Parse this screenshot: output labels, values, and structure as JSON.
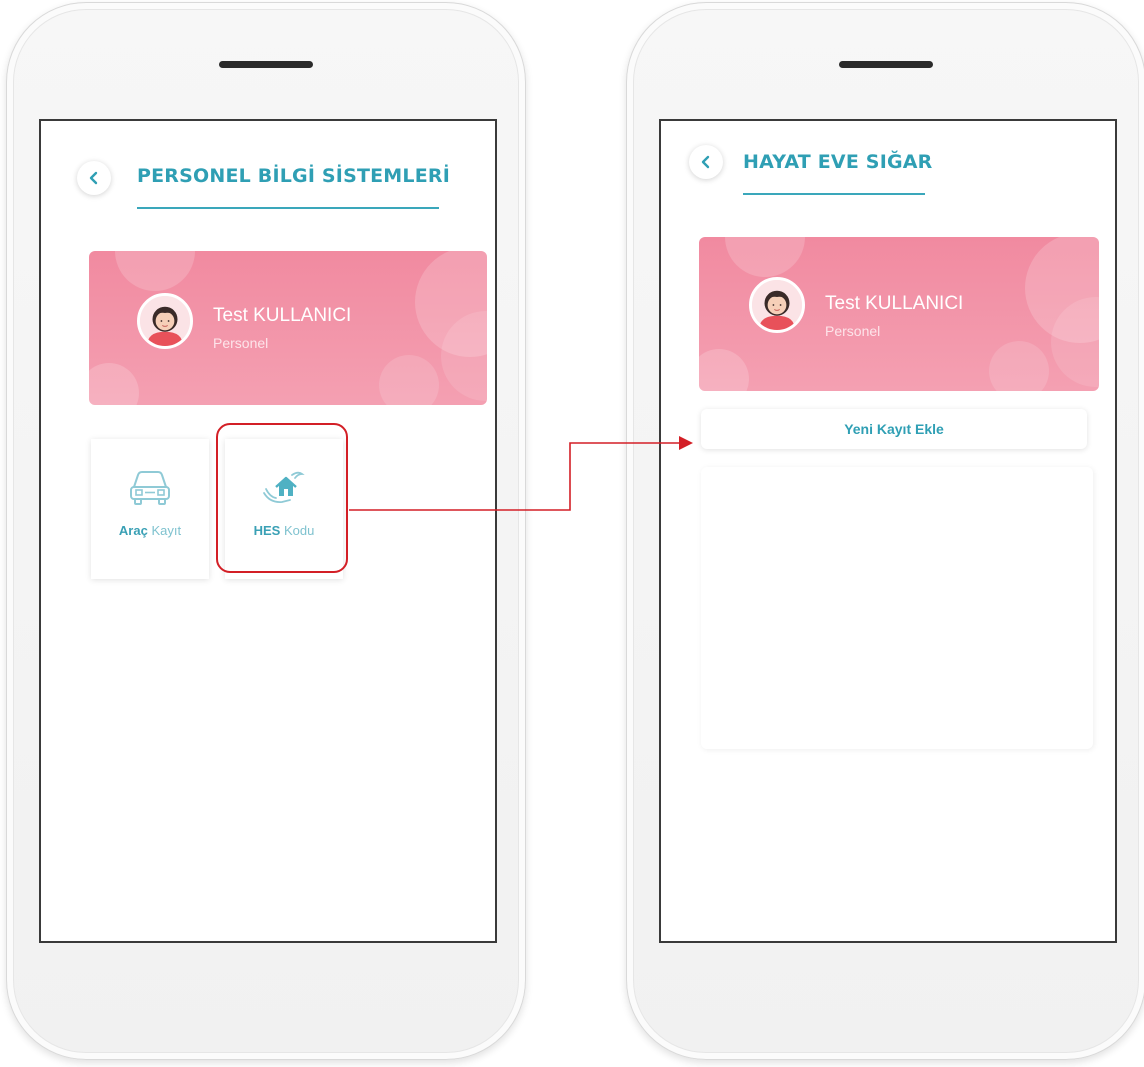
{
  "left_screen": {
    "title": "PERSONEL BİLGİ SİSTEMLERİ",
    "profile": {
      "name": "Test KULLANICI",
      "role": "Personel"
    },
    "tiles": [
      {
        "bold": "Araç",
        "text": "Kayıt",
        "icon": "car-icon"
      },
      {
        "bold": "HES",
        "text": "Kodu",
        "icon": "home-care-icon"
      }
    ]
  },
  "right_screen": {
    "title": "HAYAT EVE SIĞAR",
    "profile": {
      "name": "Test KULLANICI",
      "role": "Personel"
    },
    "new_record_label": "Yeni Kayıt Ekle"
  },
  "colors": {
    "accent": "#2f9fb4",
    "card_pink": "#f18aa0",
    "highlight_red": "#d31f26"
  }
}
